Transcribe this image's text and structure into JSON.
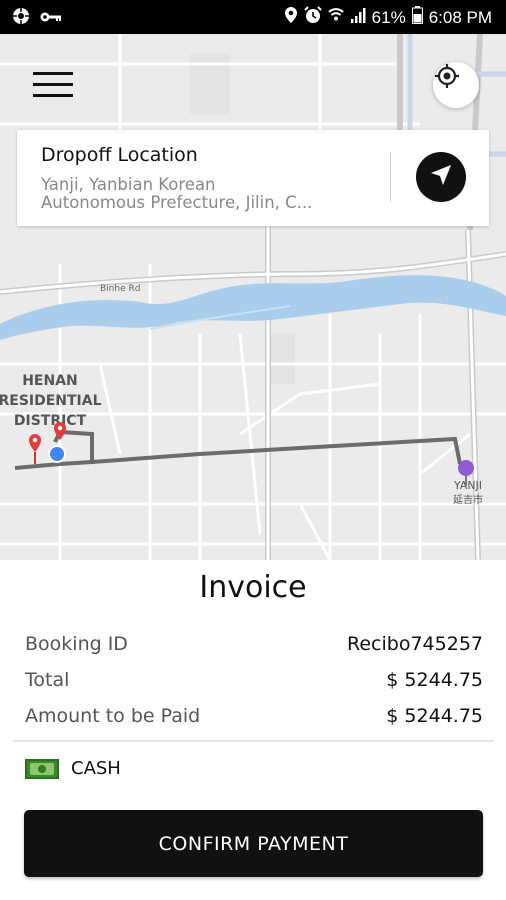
{
  "status_bar": {
    "battery": "61%",
    "time": "6:08 PM"
  },
  "icons": {
    "menu": "hamburger-menu-icon",
    "locate": "crosshair-locate-icon",
    "navigate": "navigation-arrow-icon",
    "cash": "banknote-icon"
  },
  "map": {
    "labels": {
      "district_line1": "HENAN",
      "district_line2": "RESIDENTIAL",
      "district_line3": "DISTRICT",
      "road": "Binhe Rd",
      "city": "YANJI",
      "city_cn": "延吉市"
    }
  },
  "dropoff": {
    "title": "Dropoff Location",
    "address_line1": "Yanji, Yanbian Korean",
    "address_line2": "Autonomous Prefecture, Jilin, C..."
  },
  "invoice": {
    "title": "Invoice",
    "rows": [
      {
        "label": "Booking ID",
        "value": "Recibo745257"
      },
      {
        "label": "Total",
        "value": "$ 5244.75"
      },
      {
        "label": "Amount to be Paid",
        "value": "$ 5244.75"
      }
    ],
    "payment_method": "CASH",
    "confirm_label": "CONFIRM PAYMENT"
  },
  "colors": {
    "river": "#a9cdeb",
    "route": "#6b6b6b",
    "pin_red": "#e23b3b",
    "pin_purple": "#8e5bd0",
    "current_location": "#4285f4",
    "button": "#111111"
  }
}
